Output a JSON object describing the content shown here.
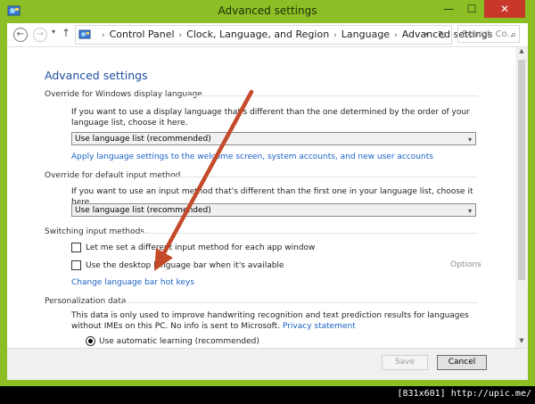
{
  "window": {
    "title": "Advanced settings",
    "controls": {
      "minimize": "—",
      "maximize": "☐",
      "close": "✕"
    }
  },
  "navigation": {
    "back_icon": "←",
    "forward_icon": "→",
    "recent_icon": "▾",
    "up_icon": "↑",
    "breadcrumbs": [
      "Control Panel",
      "Clock, Language, and Region",
      "Language",
      "Advanced settings"
    ],
    "crumb_separator": "›",
    "address_dropdown_icon": "▾",
    "refresh_icon": "↻",
    "search_placeholder": "Search Co...",
    "search_icon": "⌕"
  },
  "page": {
    "heading": "Advanced settings",
    "display_language": {
      "title": "Override for Windows display language",
      "description": "If you want to use a display language that's different than the one determined by the order of your language list, choose it here.",
      "selected": "Use language list (recommended)",
      "dropdown_icon": "▾",
      "link": "Apply language settings to the welcome screen, system accounts, and new user accounts"
    },
    "input_method": {
      "title": "Override for default input method",
      "description": "If you want to use an input method that's different than the first one in your language list, choose it here.",
      "selected": "Use language list (recommended)",
      "dropdown_icon": "▾"
    },
    "switching": {
      "title": "Switching input methods",
      "option1": "Let me set a different input method for each app window",
      "option2": "Use the desktop language bar when it's available",
      "options_link": "Options",
      "hotkeys_link": "Change language bar hot keys"
    },
    "personalization": {
      "title": "Personalization data",
      "description": "This data is only used to improve handwriting recognition and text prediction results for languages without IMEs on this PC. No info is sent to Microsoft.",
      "privacy_link": "Privacy statement",
      "radio_selected": "Use automatic learning (recommended)"
    }
  },
  "scrollbar": {
    "up_icon": "▲",
    "down_icon": "▼"
  },
  "footer": {
    "save_label": "Save",
    "cancel_label": "Cancel"
  },
  "watermark": "[831x601] http://upic.me/",
  "colors": {
    "frame": "#8cbf26",
    "close": "#c7372a",
    "link": "#1a62c8",
    "heading": "#1e4e9d",
    "annotation_arrow": "#c44a2a"
  }
}
